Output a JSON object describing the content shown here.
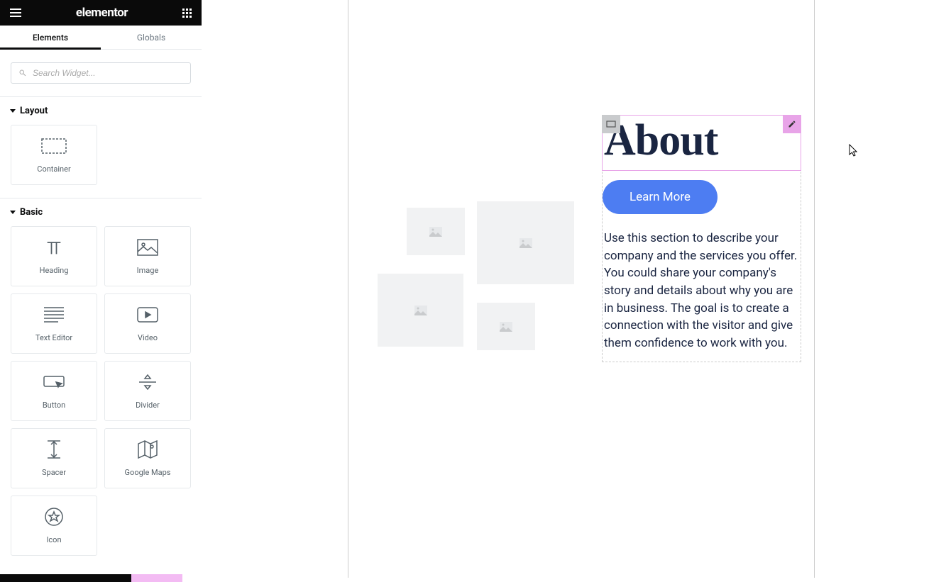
{
  "header": {
    "logo": "elementor"
  },
  "tabs": {
    "elements": "Elements",
    "globals": "Globals"
  },
  "search": {
    "placeholder": "Search Widget..."
  },
  "sections": {
    "layout": {
      "title": "Layout",
      "items": {
        "container": "Container"
      }
    },
    "basic": {
      "title": "Basic",
      "items": {
        "heading": "Heading",
        "image": "Image",
        "text_editor": "Text Editor",
        "video": "Video",
        "button": "Button",
        "divider": "Divider",
        "spacer": "Spacer",
        "google_maps": "Google Maps",
        "icon": "Icon"
      }
    }
  },
  "page": {
    "heading": "About",
    "cta": "Learn More",
    "body": "Use this section to describe your company and the services you offer. You could share your company's story and details about why you are in business. The goal is to create a connection with the visitor and give them confidence to work with you."
  }
}
